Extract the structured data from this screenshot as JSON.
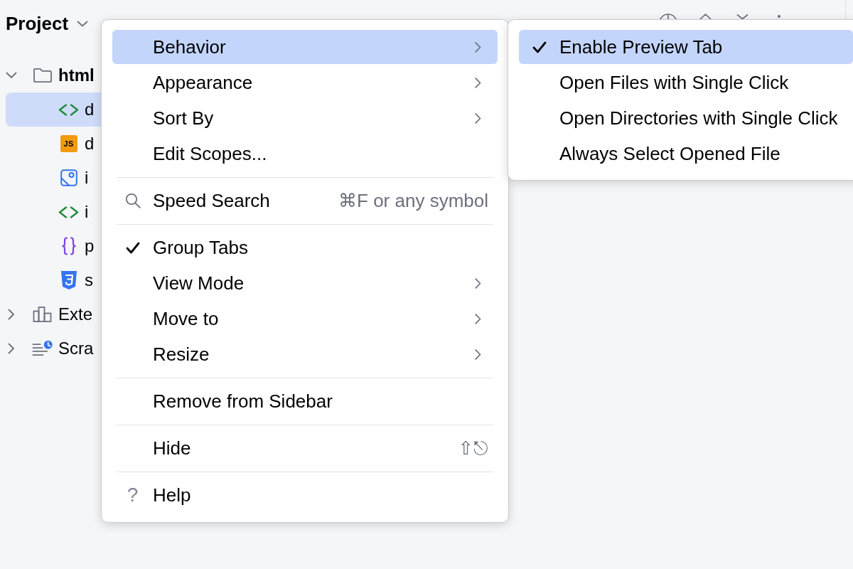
{
  "panel": {
    "title": "Project"
  },
  "tree": [
    {
      "kind": "folder",
      "label": "html",
      "expanded": true,
      "selected": false,
      "children": [
        {
          "kind": "markup",
          "label": "d",
          "selected": true
        },
        {
          "kind": "script",
          "badge": "JS",
          "label": "d",
          "selected": false
        },
        {
          "kind": "image",
          "label": "i",
          "selected": false
        },
        {
          "kind": "markup",
          "label": "i",
          "selected": false
        },
        {
          "kind": "data",
          "label": "p",
          "selected": false
        },
        {
          "kind": "stylesheet",
          "label": "s",
          "selected": false
        }
      ]
    },
    {
      "kind": "libraries",
      "label": "Exte",
      "expanded": false,
      "selected": false
    },
    {
      "kind": "scratches",
      "label": "Scra",
      "expanded": false,
      "selected": false
    }
  ],
  "menu": {
    "items": [
      {
        "kind": "item",
        "label": "Behavior",
        "selected": true,
        "checked": false,
        "submenu": true
      },
      {
        "kind": "item",
        "label": "Appearance",
        "selected": false,
        "checked": false,
        "submenu": true
      },
      {
        "kind": "item",
        "label": "Sort By",
        "selected": false,
        "checked": false,
        "submenu": true
      },
      {
        "kind": "item",
        "label": "Edit Scopes...",
        "selected": false,
        "checked": false,
        "submenu": false
      },
      {
        "kind": "separator"
      },
      {
        "kind": "search",
        "label": "Speed Search",
        "shortcut": "⌘F or any symbol",
        "selected": false,
        "checked": false,
        "submenu": false
      },
      {
        "kind": "separator"
      },
      {
        "kind": "item",
        "label": "Group Tabs",
        "selected": false,
        "checked": true,
        "submenu": false
      },
      {
        "kind": "item",
        "label": "View Mode",
        "selected": false,
        "checked": false,
        "submenu": true
      },
      {
        "kind": "item",
        "label": "Move to",
        "selected": false,
        "checked": false,
        "submenu": true
      },
      {
        "kind": "item",
        "label": "Resize",
        "selected": false,
        "checked": false,
        "submenu": true
      },
      {
        "kind": "separator"
      },
      {
        "kind": "item",
        "label": "Remove from Sidebar",
        "selected": false,
        "checked": false,
        "submenu": false
      },
      {
        "kind": "separator"
      },
      {
        "kind": "item",
        "label": "Hide",
        "shortcut": "⇧⎋",
        "selected": false,
        "checked": false,
        "submenu": false
      },
      {
        "kind": "separator"
      },
      {
        "kind": "help",
        "glyph": "?",
        "label": "Help",
        "selected": false,
        "checked": false,
        "submenu": false
      }
    ]
  },
  "submenu": {
    "items": [
      {
        "kind": "item",
        "label": "Enable Preview Tab",
        "selected": true,
        "checked": true
      },
      {
        "kind": "item",
        "label": "Open Files with Single Click",
        "selected": false,
        "checked": false
      },
      {
        "kind": "item",
        "label": "Open Directories with Single Click",
        "selected": false,
        "checked": false
      },
      {
        "kind": "item",
        "label": "Always Select Opened File",
        "selected": false,
        "checked": false
      }
    ]
  }
}
